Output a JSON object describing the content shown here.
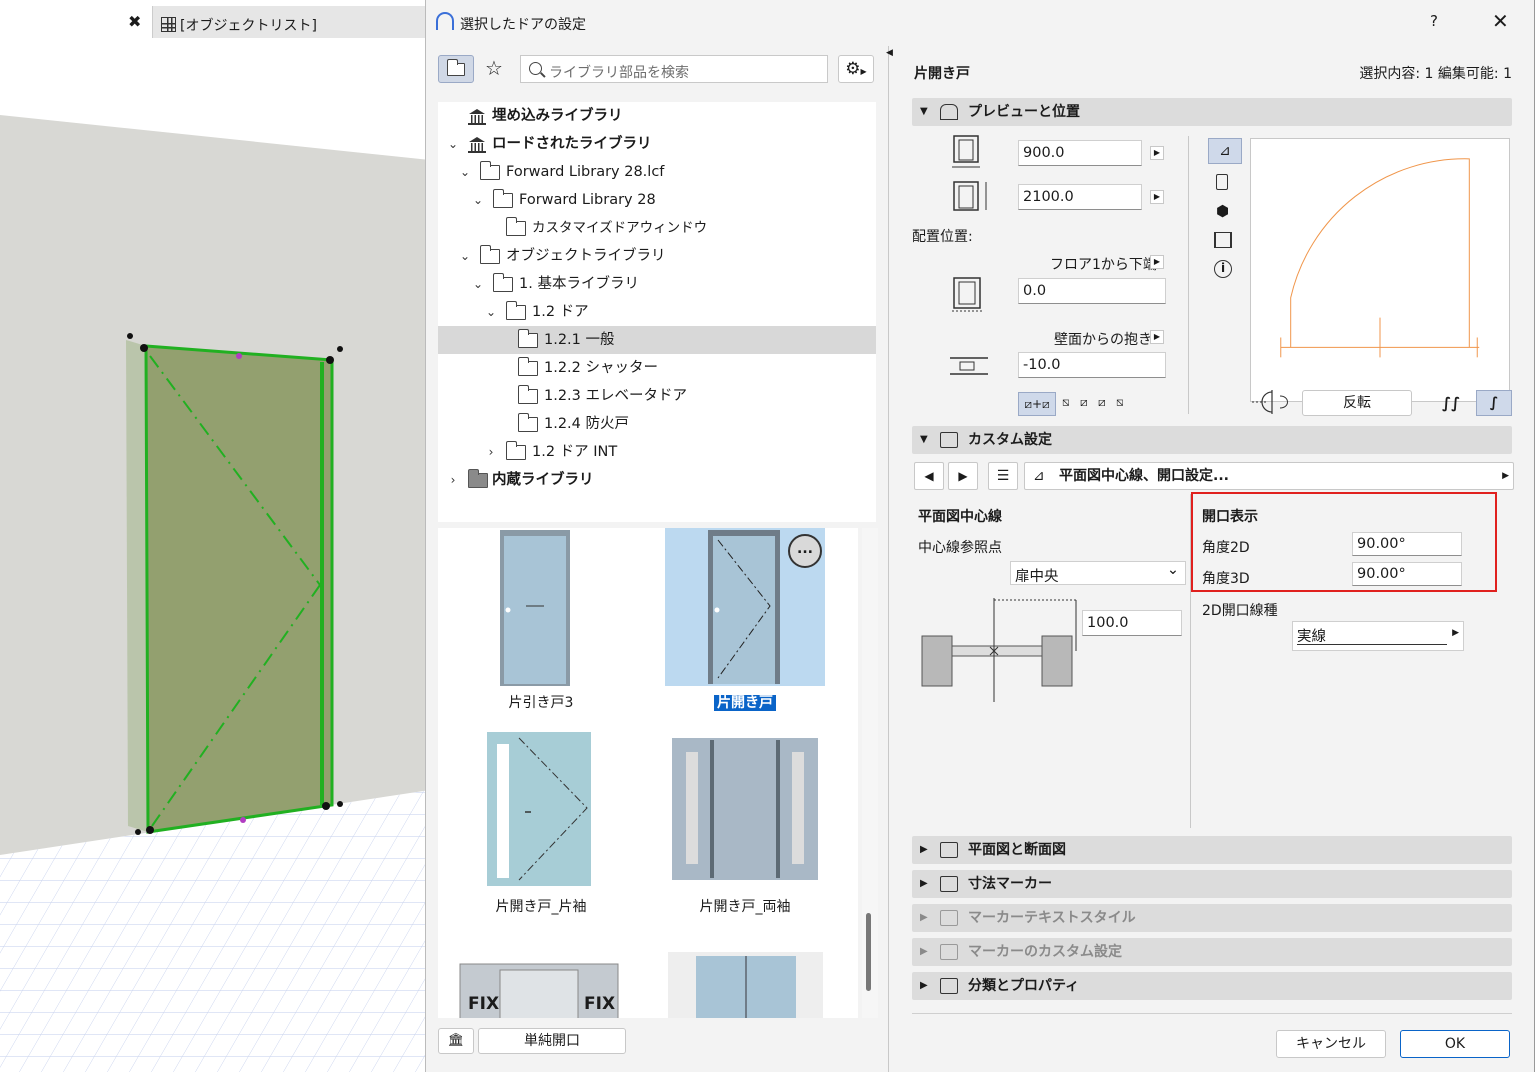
{
  "background_tabs": {
    "close_glyph": "✖",
    "object_list_tab": "[オブジェクトリスト]"
  },
  "dialog": {
    "title": "選択したドアの設定",
    "help": "?",
    "close": "✕"
  },
  "library": {
    "search_placeholder": "ライブラリ部品を検索",
    "tree": [
      {
        "label": "埋め込みライブラリ",
        "bold": true
      },
      {
        "label": "ロードされたライブラリ",
        "bold": true
      },
      {
        "label": "Forward Library 28.lcf"
      },
      {
        "label": "Forward Library 28"
      },
      {
        "label": "カスタマイズドアウィンドウ"
      },
      {
        "label": "オブジェクトライブラリ"
      },
      {
        "label": "1. 基本ライブラリ"
      },
      {
        "label": "1.2 ドア"
      },
      {
        "label": "1.2.1 一般",
        "selected": true
      },
      {
        "label": "1.2.2 シャッター"
      },
      {
        "label": "1.2.3 エレベータドア"
      },
      {
        "label": "1.2.4 防火戸"
      },
      {
        "label": "1.2 ドア INT"
      },
      {
        "label": "内蔵ライブラリ",
        "bold": true
      }
    ],
    "thumbnails": [
      {
        "label": "片引き戸3"
      },
      {
        "label": "片開き戸",
        "selected": true
      },
      {
        "label": "片開き戸_片袖"
      },
      {
        "label": "片開き戸_両袖"
      },
      {
        "label": "FIX"
      },
      {
        "label": "FIX"
      }
    ],
    "more_glyph": "...",
    "simple_opening_button": "単純開口"
  },
  "settings": {
    "object_name": "片開き戸",
    "selection_info": "選択内容: 1 編集可能: 1",
    "preview_section": {
      "title": "プレビューと位置",
      "width": "900.0",
      "height": "2100.0",
      "placement_label": "配置位置:",
      "floor_ref_label": "フロア1から下端",
      "floor_ref_value": "0.0",
      "wall_ref_label": "壁面からの抱き",
      "wall_ref_value": "-10.0",
      "flip_button": "反転"
    },
    "custom_section": {
      "title": "カスタム設定",
      "nav_path": "平面図中心線、開口設定...",
      "centerline_title": "平面図中心線",
      "centerline_ref_label": "中心線参照点",
      "centerline_ref_value": "扉中央",
      "offset_value": "100.0",
      "opening_title": "開口表示",
      "angle2d_label": "角度2D",
      "angle2d_value": "90.00°",
      "angle3d_label": "角度3D",
      "angle3d_value": "90.00°",
      "line_type_label": "2D開口線種",
      "line_type_value": "実線"
    },
    "sections": [
      {
        "label": "平面図と断面図",
        "enabled": true
      },
      {
        "label": "寸法マーカー",
        "enabled": true
      },
      {
        "label": "マーカーテキストスタイル",
        "enabled": false
      },
      {
        "label": "マーカーのカスタム設定",
        "enabled": false
      },
      {
        "label": "分類とプロパティ",
        "enabled": true
      }
    ],
    "cancel_button": "キャンセル",
    "ok_button": "OK"
  },
  "colors": {
    "accent": "#0a64c8",
    "highlight_box": "#e0201e",
    "door_green": "#21b021",
    "door_fill": "#8c9a64",
    "swing_orange": "#f0964b"
  }
}
